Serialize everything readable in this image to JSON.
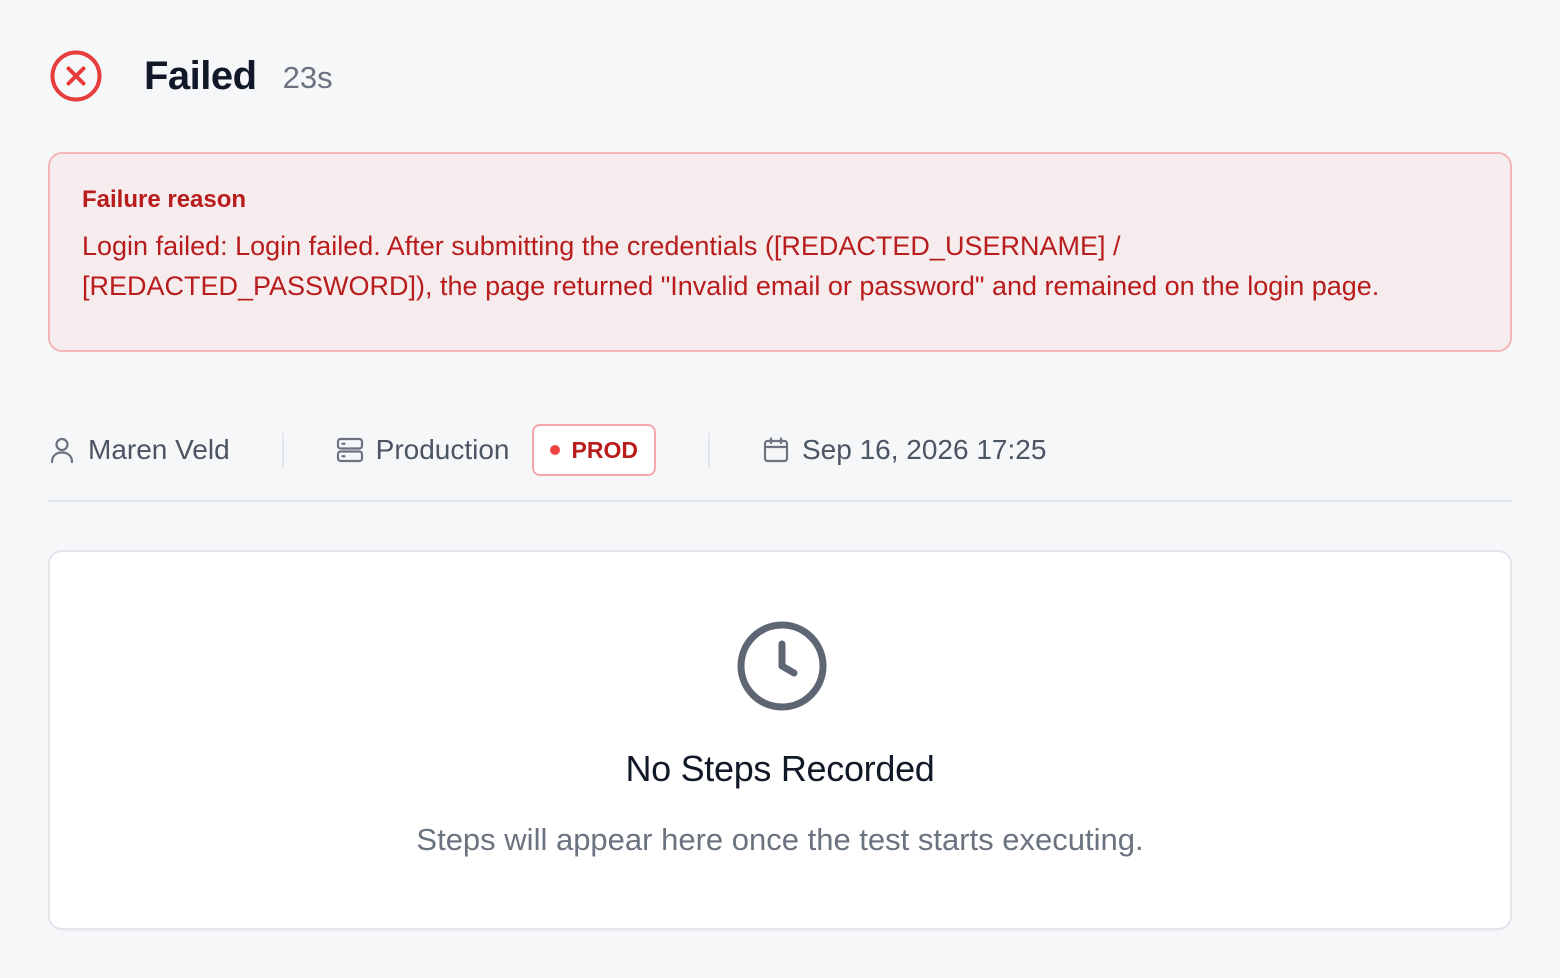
{
  "header": {
    "status_icon": "x-circle-icon",
    "status": "Failed",
    "duration": "23s",
    "error_color": "#e53e3e"
  },
  "failure": {
    "label": "Failure reason",
    "message": "Login failed: Login failed. After submitting the credentials ([REDACTED_USERNAME] / [REDACTED_PASSWORD]), the page returned \"Invalid email or password\" and remained on the login page.",
    "text_color": "#b91c1c",
    "background": "#f6eced"
  },
  "meta": {
    "user": {
      "icon": "user-icon",
      "name": "Maren Veld"
    },
    "environment": {
      "icon": "server-icon",
      "name": "Production",
      "badge": "PROD",
      "badge_dot_color": "#ef4444"
    },
    "date": {
      "icon": "calendar-icon",
      "value": "Sep 16, 2026 17:25"
    }
  },
  "steps": {
    "empty_icon": "clock-icon",
    "empty_title": "No Steps Recorded",
    "empty_subtitle": "Steps will appear here once the test starts executing."
  }
}
